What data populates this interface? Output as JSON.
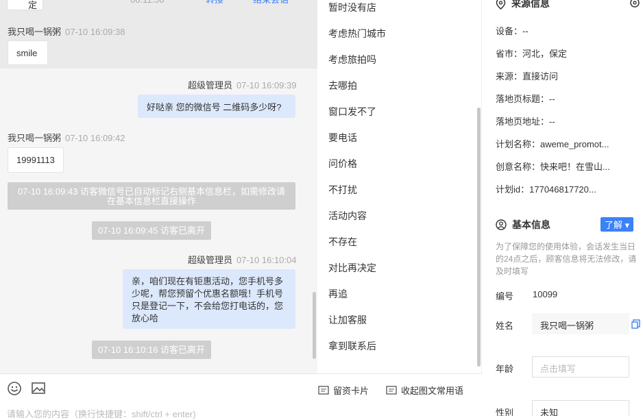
{
  "chat": {
    "top_partial": {
      "stub": "定",
      "col_time": "00:11:50",
      "col_a": "转接",
      "col_b": "结束会话"
    },
    "messages": [
      {
        "type": "in",
        "name": "我只喝一锅粥",
        "time": "07-10 16:09:38",
        "text": "smile"
      },
      {
        "type": "out",
        "name": "超级管理员",
        "time": "07-10 16:09:39",
        "text": "好哒亲  您的微信号 二维码多少呀?"
      },
      {
        "type": "in",
        "name": "我只喝一锅粥",
        "time": "07-10 16:09:42",
        "text": "19991113"
      },
      {
        "type": "sys",
        "line1": "07-10 16:09:43 访客微信号已自动标记右侧基本信息栏，如需修改请",
        "line2": "在基本信息栏直接操作"
      },
      {
        "type": "sys",
        "text": "07-10 16:09:45 访客已离开"
      },
      {
        "type": "out",
        "name": "超级管理员",
        "time": "07-10 16:10:04",
        "lines": [
          "亲，咱们现在有钜惠活动，您手机号多",
          "少呢，帮您预留个优惠名额哦！手机号",
          "只是登记一下，不会给您打电话的，您",
          "放心哈"
        ]
      },
      {
        "type": "sys",
        "text": "07-10 16:10:16 访客已离开"
      }
    ]
  },
  "toolbar": {
    "card_label": "留资卡片",
    "phrases_label": "收起图文常用语",
    "input_placeholder": "请输入您的内容（换行快捷键：shift/ctrl + enter)"
  },
  "phrases": [
    "暂时没有店",
    "考虑热门城市",
    "考虑旅拍吗",
    "去哪拍",
    "窗口发不了",
    "要电话",
    "问价格",
    "不打扰",
    "活动内容",
    "不存在",
    "对比再决定",
    "再追",
    "让加客服",
    "拿到联系后"
  ],
  "info": {
    "source_title": "来源信息",
    "source": [
      {
        "k": "设备：",
        "v": "--"
      },
      {
        "k": "省市：",
        "v": "河北，保定"
      },
      {
        "k": "来源：",
        "v": "直接访问"
      },
      {
        "k": "落地页标题：",
        "v": "--"
      },
      {
        "k": "落地页地址：",
        "v": "--"
      },
      {
        "k": "计划名称：",
        "v": "aweme_promot..."
      },
      {
        "k": "创意名称：",
        "v": "快来吧！在雪山..."
      },
      {
        "k": "计划id：",
        "v": "177046817720..."
      }
    ],
    "basic_title": "基本信息",
    "learn_more": "了解",
    "notice": "为了保障您的使用体验，会话发生当日的24点之后，顾客信息将无法修改，请及时填写",
    "id_label": "编号",
    "id_value": "10099",
    "name_label": "姓名",
    "name_value": "我只喝一锅粥",
    "age_label": "年龄",
    "age_placeholder": "点击填写",
    "gender_label": "性别",
    "gender_value": "未知"
  },
  "colors": {
    "accent": "#3b82f6",
    "bubble_out": "#dce8fb",
    "system": "#cfcfcf"
  }
}
